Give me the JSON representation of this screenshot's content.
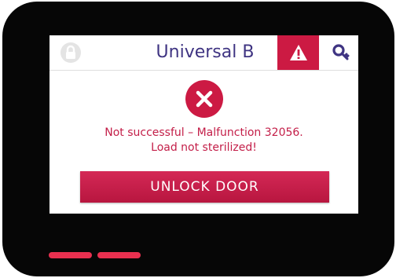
{
  "header": {
    "title": "Universal B",
    "lock_icon": "lock-icon",
    "warning_icon": "warning-icon",
    "key_icon": "key-icon"
  },
  "alert": {
    "icon": "error-x-icon",
    "line1": "Not successful – Malfunction 32056.",
    "line2": "Load not sterilized!"
  },
  "actions": {
    "unlock_label": "UNLOCK DOOR"
  },
  "colors": {
    "accent": "#cc1a43",
    "title": "#3f3482",
    "message": "#c31e48",
    "bezel": "#060606",
    "led": "#e8304f"
  },
  "indicators": {
    "led_count": 2
  }
}
